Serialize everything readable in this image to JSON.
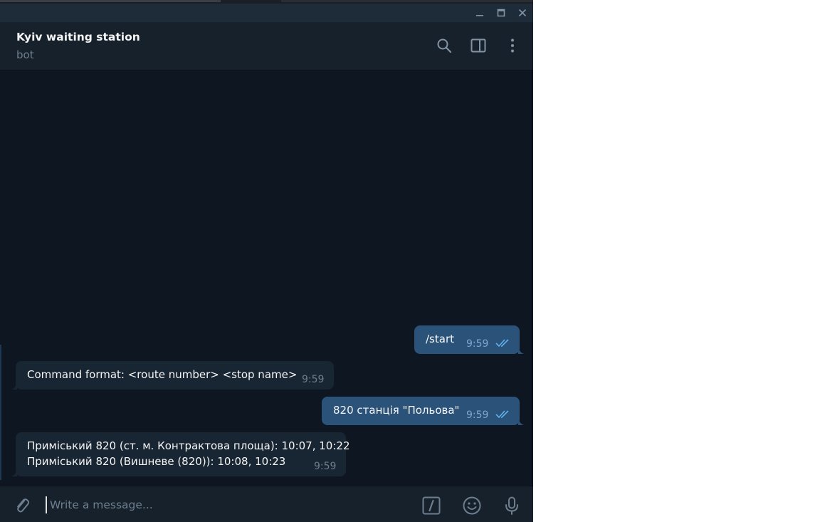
{
  "window": {
    "controls": [
      "minimize-icon",
      "maximize-icon",
      "close-icon"
    ]
  },
  "header": {
    "title": "Kyiv waiting station",
    "status": "bot",
    "icons": [
      "search-icon",
      "sidebar-toggle-icon",
      "more-vertical-icon"
    ]
  },
  "messages": [
    {
      "direction": "out",
      "text": "/start",
      "time": "9:59",
      "read": true
    },
    {
      "direction": "in",
      "text": "Command format: <route number> <stop name>",
      "time": "9:59"
    },
    {
      "direction": "out",
      "text": "820 станція \"Польова\"",
      "time": "9:59",
      "read": true
    },
    {
      "direction": "in",
      "lines": [
        "Приміський 820 (ст. м. Контрактова площа): 10:07, 10:22",
        "Приміський 820 (Вишневе (820)): 10:08, 10:23"
      ],
      "time": "9:59"
    }
  ],
  "composer": {
    "placeholder": "Write a message...",
    "icons": [
      "attach-icon",
      "bot-commands-icon",
      "emoji-icon",
      "microphone-icon"
    ]
  },
  "colors": {
    "background": "#0e1621",
    "header": "#17212b",
    "outgoing_bubble": "#2b5278",
    "incoming_bubble": "#182533",
    "read_ticks": "#5fb0ed"
  }
}
